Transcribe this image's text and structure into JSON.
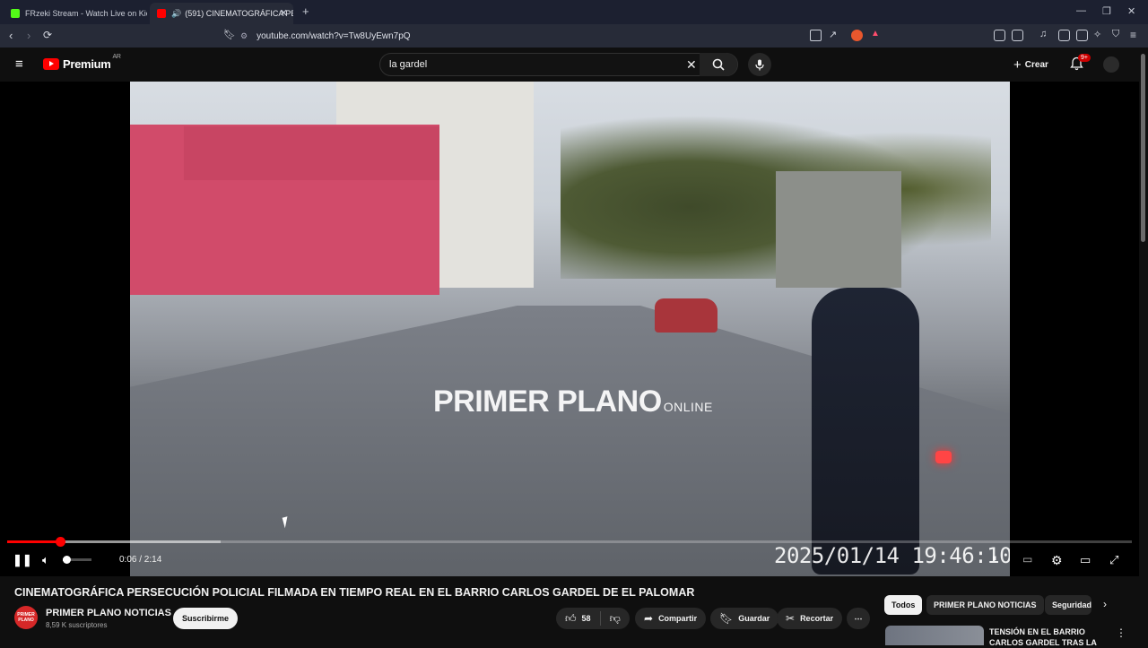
{
  "browser": {
    "tabs": [
      {
        "label": "FRzeki Stream - Watch Live on Kick",
        "favicon_color": "#53fc18"
      },
      {
        "label": "(591) CINEMATOGRÁFICA PE",
        "favicon_color": "#ff0000"
      }
    ],
    "new_tab": "+",
    "url": "youtube.com/watch?v=Tw8UyEwn7pQ"
  },
  "header": {
    "logo_text": "Premium",
    "region": "AR",
    "search_value": "la gardel",
    "create_label": "Crear",
    "notifications_badge": "9+"
  },
  "player": {
    "watermark": "PRIMER PLANO",
    "watermark_suffix": "ONLINE",
    "timestamp_overlay": "2025/01/14 19:46:10",
    "time_display": "0:06 / 2:14",
    "progress_fraction": 0.0467,
    "buffered_fraction": 0.19,
    "volume_fraction": 0.12,
    "accent_color": "#ff0000"
  },
  "video": {
    "title": "CINEMATOGRÁFICA PERSECUCIÓN POLICIAL FILMADA EN TIEMPO REAL EN EL BARRIO CARLOS GARDEL DE EL PALOMAR",
    "channel_name": "PRIMER PLANO NOTICIAS",
    "channel_avatar_text": "PRIMER PLANO",
    "subscribers": "8,59 K suscriptores",
    "subscribe_label": "Suscribirme",
    "likes": "58",
    "share_label": "Compartir",
    "save_label": "Guardar",
    "clip_label": "Recortar"
  },
  "sidebar": {
    "chips": [
      "Todos",
      "PRIMER PLANO NOTICIAS",
      "Seguridad"
    ],
    "suggestion_title": "TENSIÓN EN EL BARRIO CARLOS GARDEL TRAS LA"
  }
}
